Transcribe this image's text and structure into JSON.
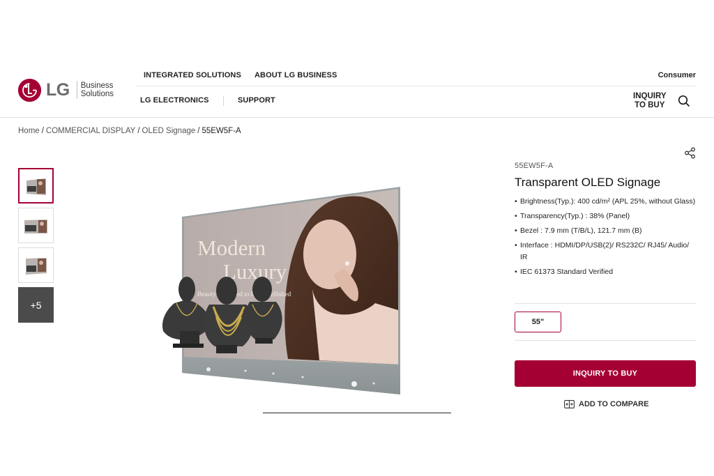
{
  "brand": {
    "logo_text": "LG",
    "business_line1": "Business",
    "business_line2": "Solutions",
    "accent_color": "#a50034"
  },
  "nav": {
    "top_items": [
      "INTEGRATED SOLUTIONS",
      "ABOUT LG BUSINESS"
    ],
    "bottom_items": [
      "LG ELECTRONICS",
      "SUPPORT"
    ],
    "consumer_label": "Consumer",
    "inquiry_line1": "INQUIRY",
    "inquiry_line2": "TO BUY",
    "search_icon": "search-icon"
  },
  "breadcrumb": [
    "Home",
    "COMMERCIAL DISPLAY",
    "OLED Signage",
    "55EW5F-A"
  ],
  "gallery": {
    "more_label": "+5",
    "hero_headline1": "Modern",
    "hero_headline2": "Luxury",
    "hero_tagline": "Beauty is needed to be embellished"
  },
  "product": {
    "model": "55EW5F-A",
    "title": "Transparent OLED Signage",
    "specs": [
      "Brightness(Typ.): 400 cd/m² (APL 25%, without Glass)",
      "Transparency(Typ.) : 38% (Panel)",
      "Bezel : 7.9 mm (T/B/L), 121.7 mm (B)",
      "Interface : HDMI/DP/USB(2)/ RS232C/ RJ45/ Audio/ IR",
      "IEC 61373 Standard Verified"
    ],
    "size_option": "55\"",
    "cta_label": "INQUIRY TO BUY",
    "compare_label": "ADD TO COMPARE"
  }
}
